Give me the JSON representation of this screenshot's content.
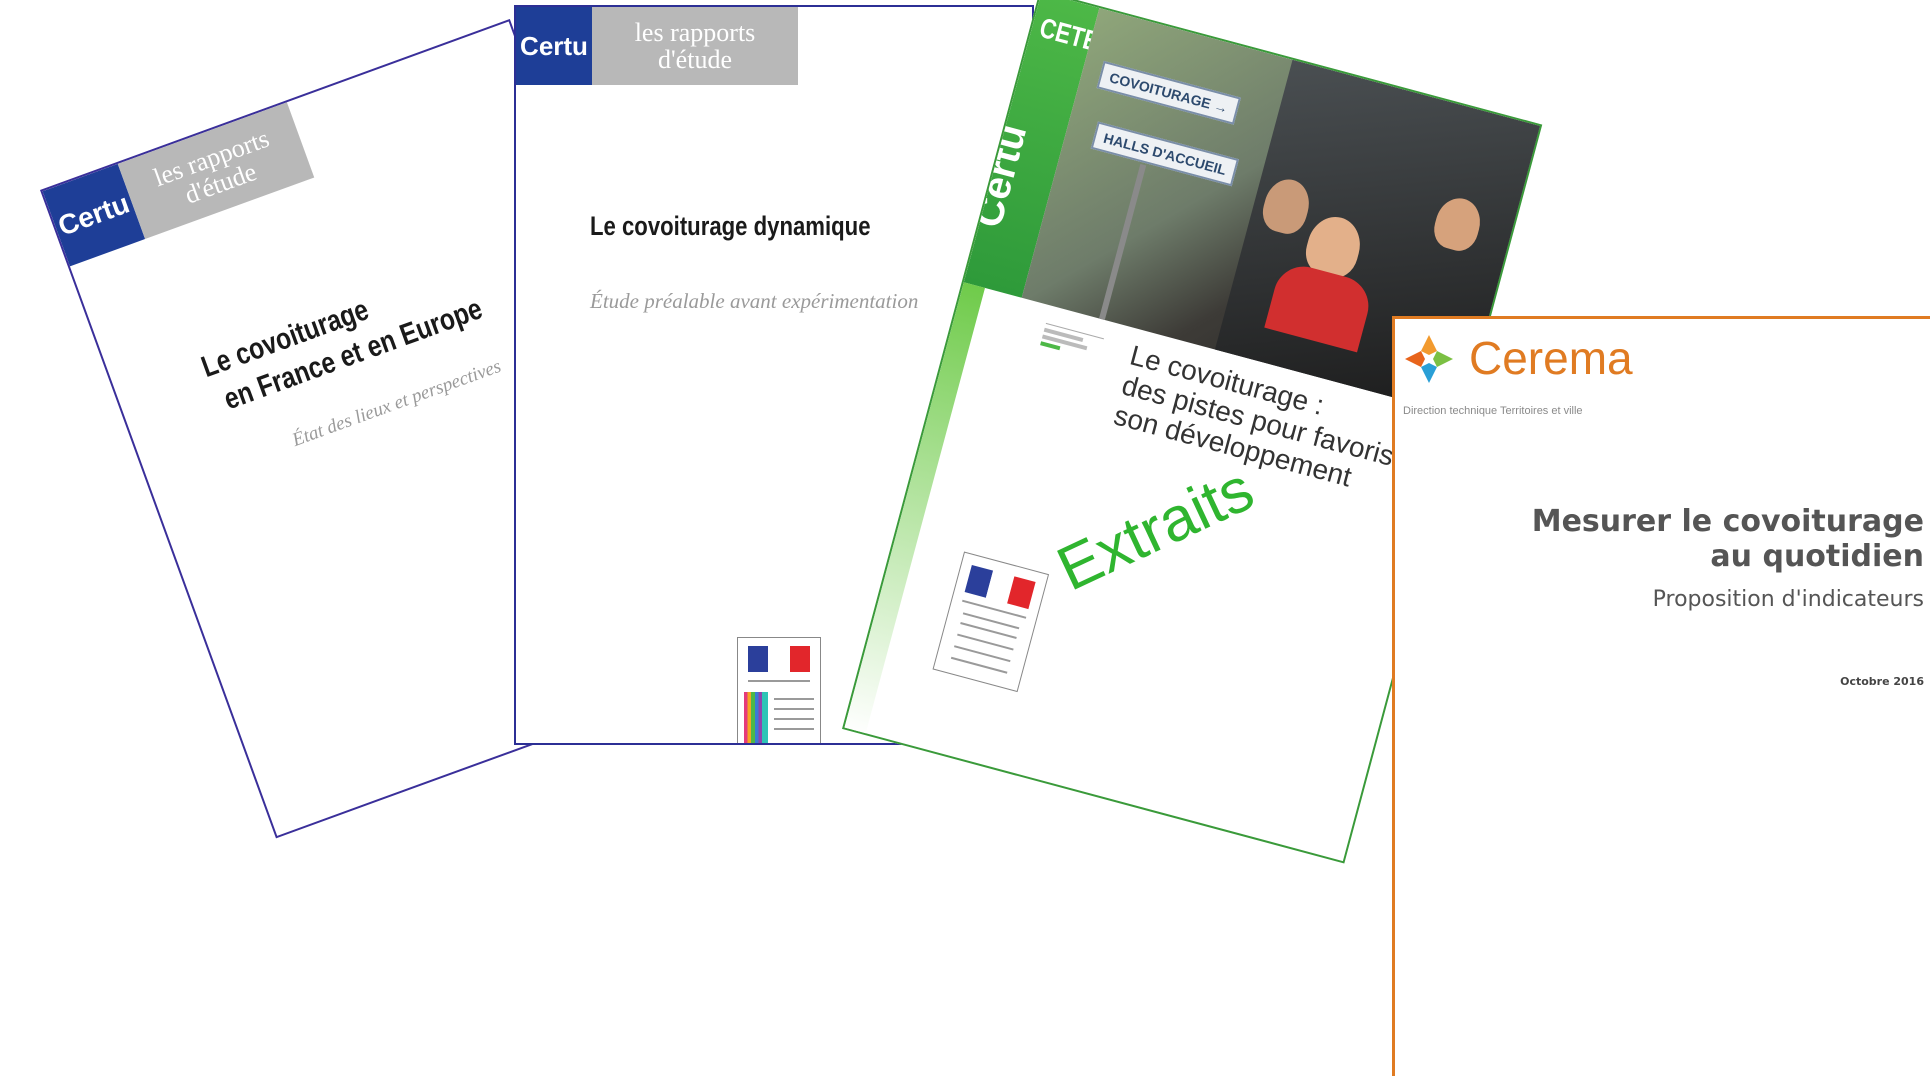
{
  "covers": [
    {
      "series_brand": "Certu",
      "series_name_line1": "les rapports",
      "series_name_line2": "d'étude",
      "title_line1": "Le covoiturage",
      "title_line2": "en France et en Europe",
      "subtitle": "État des lieux et perspectives"
    },
    {
      "series_brand": "Certu",
      "series_name_line1": "les rapports",
      "series_name_line2": "d'étude",
      "title": "Le covoiturage dynamique",
      "subtitle": "Étude préalable avant expérimentation"
    },
    {
      "brand_top": "CETE",
      "brand_side": "Certu",
      "sign_1": "COVOITURAGE →",
      "sign_2": "HALLS D'ACCUEIL",
      "title_line1": "Le covoiturage :",
      "title_line2": "des pistes pour favoris",
      "title_line3": "son développement",
      "stamp": "Extraits"
    },
    {
      "logo_text": "Cerema",
      "directorate": "Direction technique Territoires et ville",
      "title_line1": "Mesurer le covoiturage",
      "title_line2": "au quotidien",
      "subtitle": "Proposition d'indicateurs",
      "date": "Octobre 2016"
    }
  ],
  "colors": {
    "certu_blue": "#1e3e97",
    "rapports_grey": "#b8b8b8",
    "cete_green": "#3aa83a",
    "cerema_orange": "#e07b22",
    "extraits_green": "#2fb52f"
  }
}
